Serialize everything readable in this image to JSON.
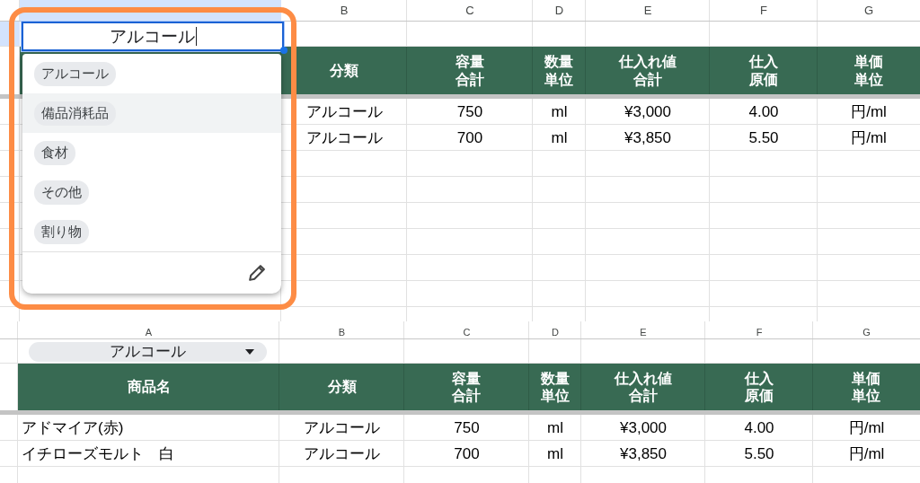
{
  "top_sheet": {
    "selected_column_header": true,
    "columns": [
      "B",
      "C",
      "D",
      "E",
      "F",
      "G"
    ],
    "editor": {
      "value": "アルコール",
      "row_selected": true
    },
    "header_row": [
      "分類",
      "容量合計",
      "数量単位",
      "仕入れ値合計",
      "仕入原価",
      "単価単位"
    ],
    "rows": [
      [
        "アルコール",
        "750",
        "ml",
        "¥3,000",
        "4.00",
        "円/ml"
      ],
      [
        "アルコール",
        "700",
        "ml",
        "¥3,850",
        "5.50",
        "円/ml"
      ]
    ]
  },
  "dropdown": {
    "options": [
      {
        "label": "アルコール",
        "highlighted": false
      },
      {
        "label": "備品消耗品",
        "highlighted": true
      },
      {
        "label": "食材",
        "highlighted": false
      },
      {
        "label": "その他",
        "highlighted": false
      },
      {
        "label": "割り物",
        "highlighted": false
      }
    ]
  },
  "bottom_sheet": {
    "columns": [
      "A",
      "B",
      "C",
      "D",
      "E",
      "F",
      "G"
    ],
    "filter_chip": {
      "value": "アルコール"
    },
    "header_row": [
      "商品名",
      "分類",
      "容量合計",
      "数量単位",
      "仕入れ値合計",
      "仕入原価",
      "単価単位"
    ],
    "rows": [
      [
        "アドマイア(赤)",
        "アルコール",
        "750",
        "ml",
        "¥3,000",
        "4.00",
        "円/ml"
      ],
      [
        "イチローズモルト　白",
        "アルコール",
        "700",
        "ml",
        "¥3,850",
        "5.50",
        "円/ml"
      ]
    ]
  }
}
